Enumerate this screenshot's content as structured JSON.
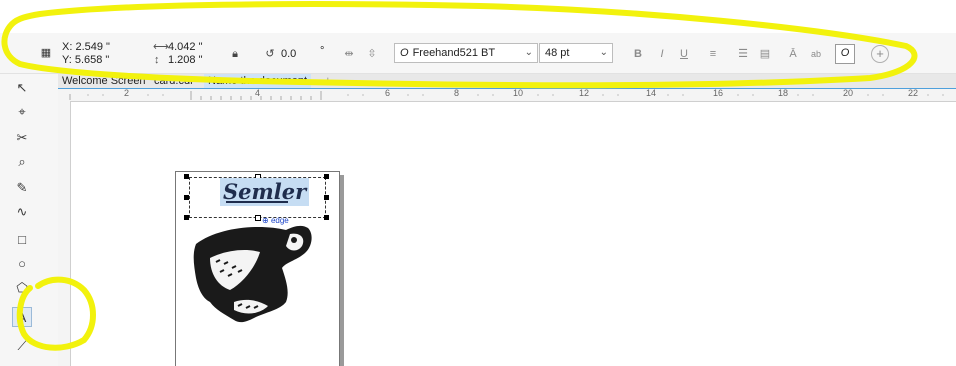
{
  "propbar": {
    "x": "X: 2.549 \"",
    "y": "Y: 5.658 \"",
    "width": "4.042 \"",
    "height": "1.208 \"",
    "width_icon": "⟷",
    "height_icon": "↕",
    "rotation": "0.0",
    "degree": "°",
    "font_name": "Freehand521 BT",
    "font_icon": "O",
    "font_size": "48 pt",
    "italic_char": "O"
  },
  "tabs": [
    {
      "label": "Welcome Screen"
    },
    {
      "label": "card.cdr"
    },
    {
      "label": "Name the document"
    }
  ],
  "tab_add": "+",
  "ruler": {
    "labels": [
      "2",
      "4",
      "6",
      "8",
      "10",
      "12",
      "14",
      "16",
      "18",
      "20",
      "22"
    ]
  },
  "canvas": {
    "text_object": "Semler",
    "edge_label": "edge"
  },
  "colors": {
    "highlight": "#f2f20d",
    "accent": "#4ea0dc"
  }
}
